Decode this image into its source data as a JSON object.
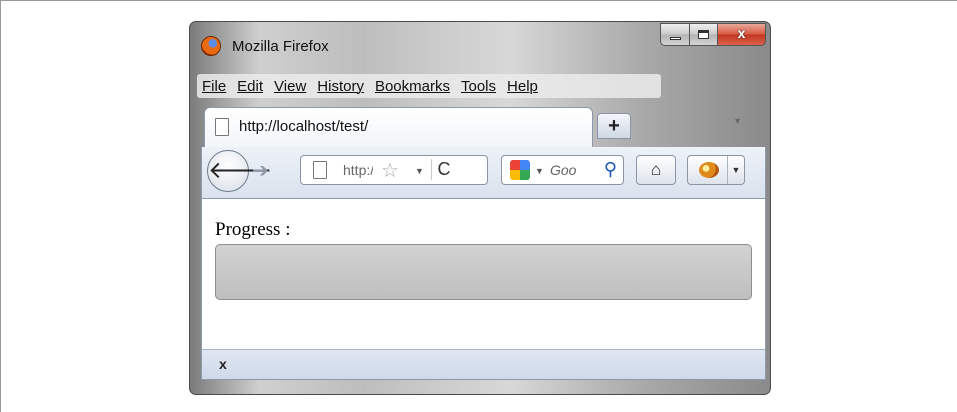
{
  "window": {
    "title": "Mozilla Firefox",
    "caption": {
      "minimize": "",
      "maximize": "",
      "close": "x"
    }
  },
  "menubar": {
    "items": [
      {
        "label": "File"
      },
      {
        "label": "Edit"
      },
      {
        "label": "View"
      },
      {
        "label": "History"
      },
      {
        "label": "Bookmarks"
      },
      {
        "label": "Tools"
      },
      {
        "label": "Help"
      }
    ]
  },
  "tabs": [
    {
      "label": "http://localhost/test/",
      "active": true
    }
  ],
  "toolbar": {
    "new_tab_label": "+",
    "back_glyph": "🡐",
    "forward_glyph": "➔",
    "url_text": "http:/.",
    "reload_glyph": "C",
    "search_text": "Goo",
    "home_glyph": "⌂",
    "search_engine_icon": "google-icon"
  },
  "page": {
    "progress_label": "Progress :",
    "progress_value": 0
  },
  "statusbar": {
    "close_label": "x"
  },
  "colors": {
    "accent": "#3c7fcd",
    "window_frame": "#4b4b4b"
  }
}
